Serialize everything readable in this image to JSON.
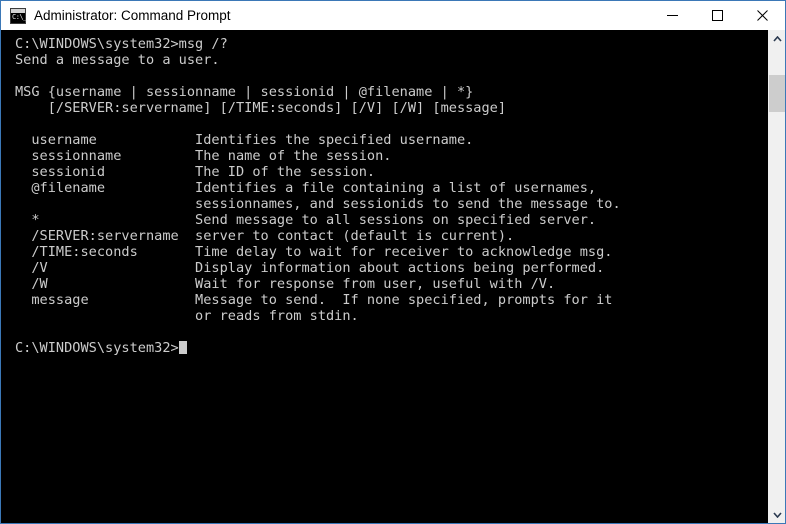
{
  "window": {
    "title": "Administrator: Command Prompt",
    "icon": "command-prompt-icon",
    "icon_glyph": "C:\\_",
    "border_color": "#3b78b7",
    "titlebar_background": "#ffffff",
    "titlebar_text_color": "#000000",
    "controls": {
      "minimize": "Minimize",
      "maximize": "Maximize",
      "close": "Close"
    }
  },
  "console": {
    "background": "#000000",
    "foreground": "#cccccc",
    "prompt": "C:\\WINDOWS\\system32>",
    "command": "msg /?",
    "cursor": "block-cursor",
    "text": "C:\\WINDOWS\\system32>msg /?\nSend a message to a user.\n\nMSG {username | sessionname | sessionid | @filename | *}\n    [/SERVER:servername] [/TIME:seconds] [/V] [/W] [message]\n\n  username            Identifies the specified username.\n  sessionname         The name of the session.\n  sessionid           The ID of the session.\n  @filename           Identifies a file containing a list of usernames,\n                      sessionnames, and sessionids to send the message to.\n  *                   Send message to all sessions on specified server.\n  /SERVER:servername  server to contact (default is current).\n  /TIME:seconds       Time delay to wait for receiver to acknowledge msg.\n  /V                  Display information about actions being performed.\n  /W                  Wait for response from user, useful with /V.\n  message             Message to send.  If none specified, prompts for it\n                      or reads from stdin.\n\n",
    "lines": [
      "C:\\WINDOWS\\system32>msg /?",
      "Send a message to a user.",
      "",
      "MSG {username | sessionname | sessionid | @filename | *}",
      "    [/SERVER:servername] [/TIME:seconds] [/V] [/W] [message]",
      "",
      "  username            Identifies the specified username.",
      "  sessionname         The name of the session.",
      "  sessionid           The ID of the session.",
      "  @filename           Identifies a file containing a list of usernames,",
      "                      sessionnames, and sessionids to send the message to.",
      "  *                   Send message to all sessions on specified server.",
      "  /SERVER:servername  server to contact (default is current).",
      "  /TIME:seconds       Time delay to wait for receiver to acknowledge msg.",
      "  /V                  Display information about actions being performed.",
      "  /W                  Wait for response from user, useful with /V.",
      "  message             Message to send.  If none specified, prompts for it",
      "                      or reads from stdin."
    ],
    "final_prompt": "C:\\WINDOWS\\system32>"
  },
  "scrollbar": {
    "up_arrow": "scroll-up-arrow",
    "down_arrow": "scroll-down-arrow",
    "track_color": "#f0f0f0",
    "thumb_color": "#cdcdcd"
  }
}
